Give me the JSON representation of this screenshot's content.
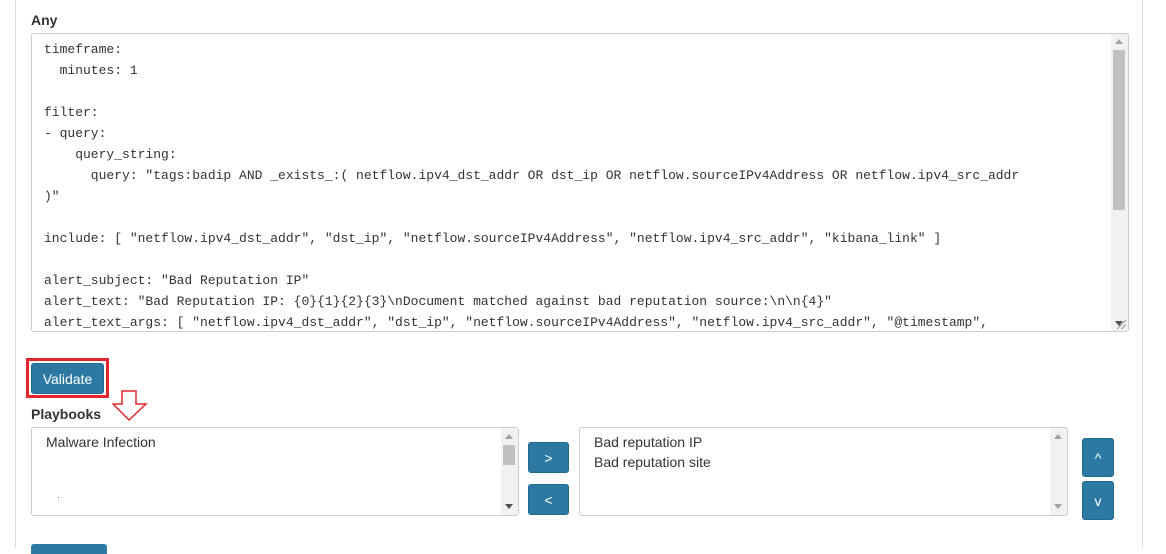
{
  "editor": {
    "label": "Any",
    "lines": [
      "timeframe:",
      "  minutes: 1",
      "",
      "filter:",
      "- query:",
      "    query_string:",
      "      query: \"tags:badip AND _exists_:( netflow.ipv4_dst_addr OR dst_ip OR netflow.sourceIPv4Address OR netflow.ipv4_src_addr",
      ")\"",
      "",
      "include: [ \"netflow.ipv4_dst_addr\", \"dst_ip\", \"netflow.sourceIPv4Address\", \"netflow.ipv4_src_addr\", \"kibana_link\" ]",
      "",
      "alert_subject: \"Bad Reputation IP\"",
      "alert_text: \"Bad Reputation IP: {0}{1}{2}{3}\\nDocument matched against bad reputation source:\\n\\n{4}\"",
      "alert_text_args: [ \"netflow.ipv4_dst_addr\", \"dst_ip\", \"netflow.sourceIPv4Address\", \"netflow.ipv4_src_addr\", \"@timestamp\","
    ],
    "scroll_fraction": 0.0
  },
  "validate": {
    "label": "Validate"
  },
  "playbooks": {
    "label": "Playbooks",
    "available": [
      "Malware Infection"
    ],
    "selected": [
      "Bad reputation IP",
      "Bad reputation site"
    ],
    "add_label": ">",
    "remove_label": "<",
    "move_up_label": "^",
    "move_down_label": "v"
  },
  "colors": {
    "button": "#2c7aa3",
    "highlight": "#e3262b"
  },
  "icons": {
    "annotation": "down-arrow-outline-icon"
  }
}
